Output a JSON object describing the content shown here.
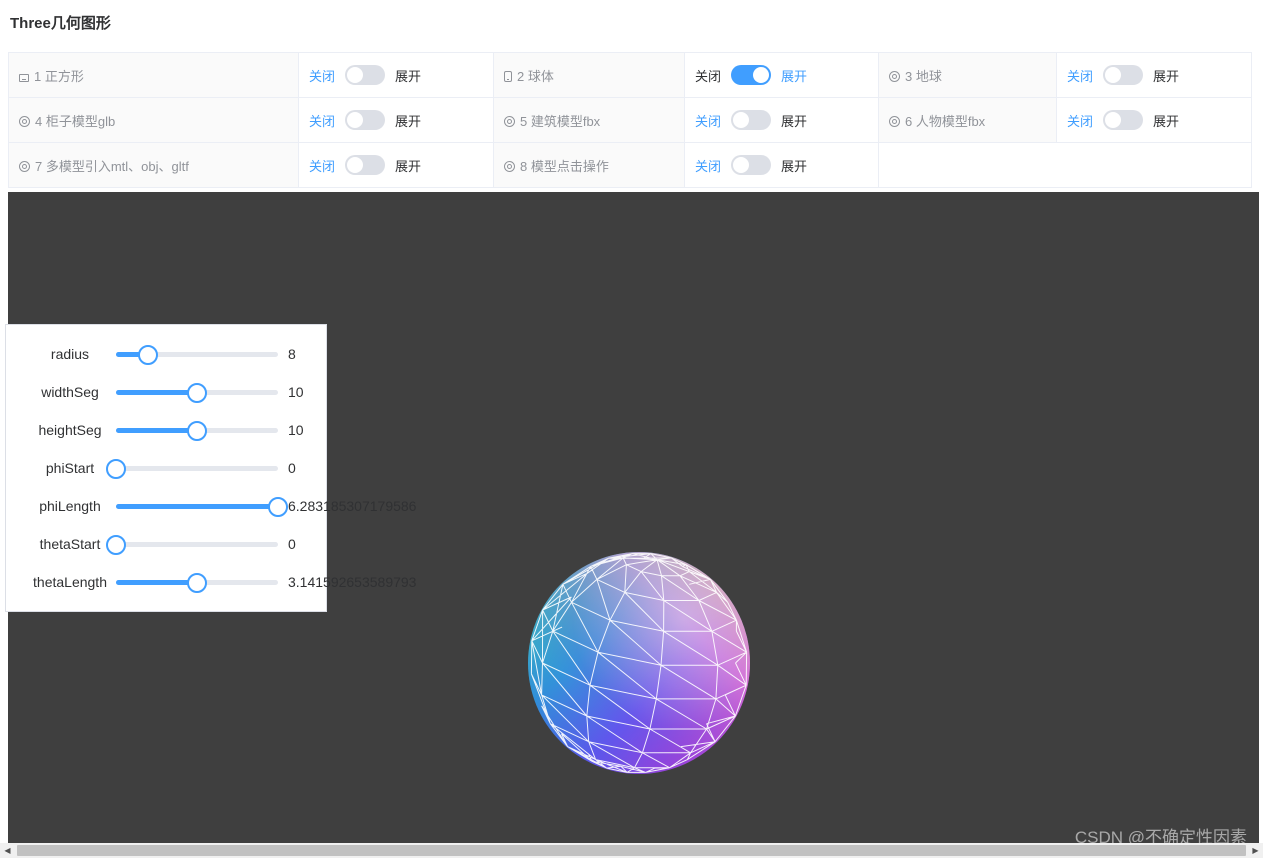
{
  "page": {
    "title": "Three几何图形"
  },
  "switch_text": {
    "off": "关闭",
    "on": "展开"
  },
  "items": [
    {
      "label": "1 正方形",
      "icon": "picture-icon",
      "enabled": false
    },
    {
      "label": "2 球体",
      "icon": "mobile-phone-icon",
      "enabled": true
    },
    {
      "label": "3 地球",
      "icon": "circle-icon",
      "enabled": false
    },
    {
      "label": "4 柜子模型glb",
      "icon": "circle-icon",
      "enabled": false
    },
    {
      "label": "5 建筑模型fbx",
      "icon": "circle-icon",
      "enabled": false
    },
    {
      "label": "6 人物模型fbx",
      "icon": "circle-icon",
      "enabled": false
    },
    {
      "label": "7 多模型引入mtl、obj、gltf",
      "icon": "circle-icon",
      "enabled": false
    },
    {
      "label": "8 模型点击操作",
      "icon": "circle-icon",
      "enabled": false
    }
  ],
  "gui": {
    "controls": [
      {
        "label": "radius",
        "value": "8",
        "fraction": 0.2
      },
      {
        "label": "widthSeg",
        "value": "10",
        "fraction": 0.5
      },
      {
        "label": "heightSeg",
        "value": "10",
        "fraction": 0.5
      },
      {
        "label": "phiStart",
        "value": "0",
        "fraction": 0.0
      },
      {
        "label": "phiLength",
        "value": "6.283185307179586",
        "fraction": 1.0
      },
      {
        "label": "thetaStart",
        "value": "0",
        "fraction": 0.0
      },
      {
        "label": "thetaLength",
        "value": "3.141592653589793",
        "fraction": 0.5
      }
    ]
  },
  "colors": {
    "accent": "#409eff",
    "canvas_bg": "#3f3f3f"
  },
  "watermark": "CSDN @不确定性因素"
}
